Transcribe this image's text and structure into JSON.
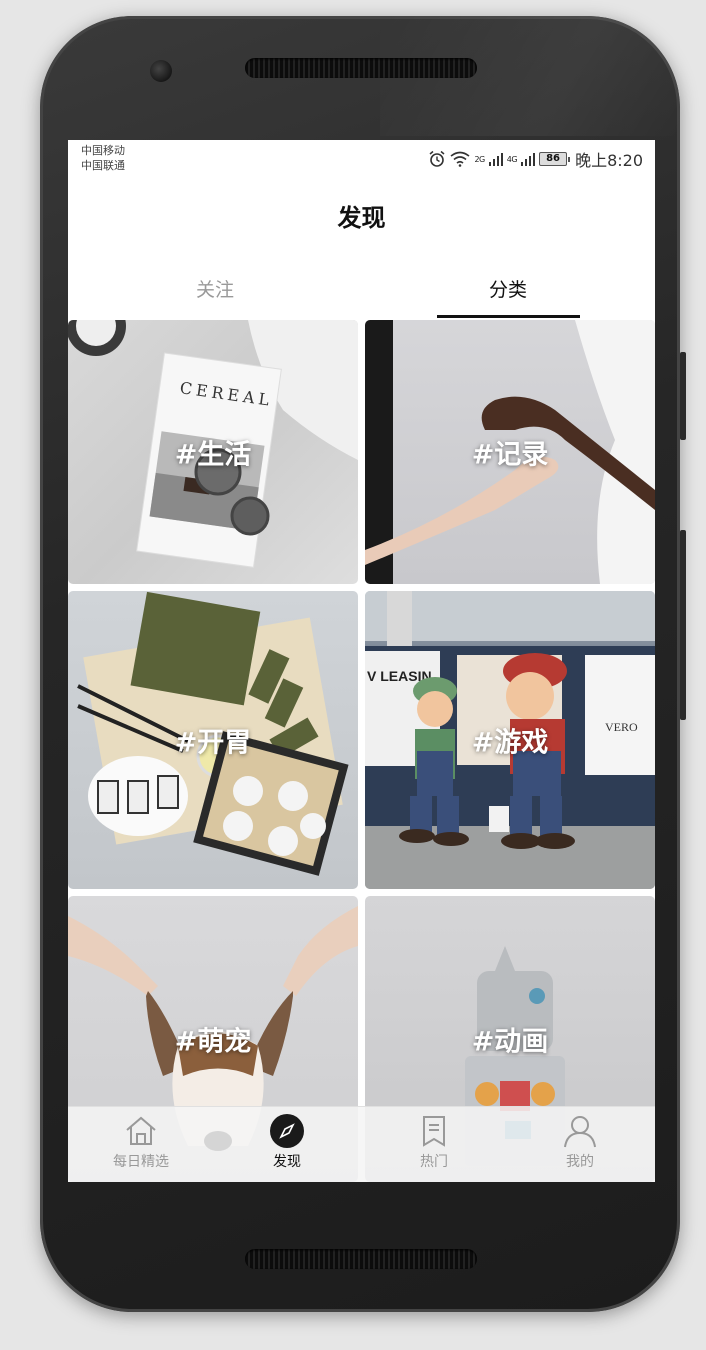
{
  "status_bar": {
    "carrier_1": "中国移动",
    "carrier_2": "中国联通",
    "net_1": "2G",
    "net_2": "4G",
    "battery": "86",
    "time": "晚上8:20"
  },
  "header": {
    "title": "发现"
  },
  "tabs": [
    {
      "label": "关注",
      "active": false
    },
    {
      "label": "分类",
      "active": true
    }
  ],
  "categories": [
    {
      "label": "#生活"
    },
    {
      "label": "#记录"
    },
    {
      "label": "#开胃"
    },
    {
      "label": "#游戏"
    },
    {
      "label": "#萌宠"
    },
    {
      "label": "#动画"
    }
  ],
  "tile_art": {
    "cereal_text": "CEREAL",
    "sign_text": "V LEASIN",
    "poster_text": "VERO"
  },
  "bottom_nav": [
    {
      "label": "每日精选",
      "icon": "home-icon",
      "active": false
    },
    {
      "label": "发现",
      "icon": "compass-icon",
      "active": true
    },
    {
      "label": "热门",
      "icon": "bookmark-icon",
      "active": false
    },
    {
      "label": "我的",
      "icon": "user-icon",
      "active": false
    }
  ],
  "colors": {
    "accent": "#111111",
    "inactive": "#999999"
  }
}
